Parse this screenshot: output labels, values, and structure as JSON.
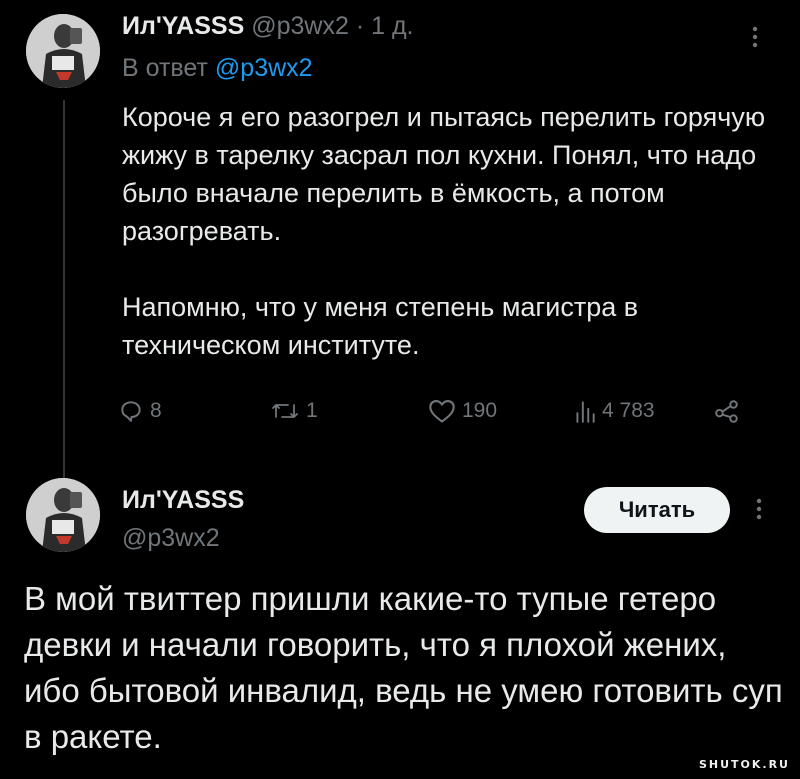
{
  "reply_tweet": {
    "author_name": "Ил'YASSS",
    "handle": "@p3wx2",
    "time_separator": "·",
    "time": "1 д.",
    "reply_to_prefix": "В ответ",
    "reply_to_handle": "@p3wx2",
    "text": "Короче я его разогрел и пытаясь перелить горячую жижу в тарелку засрал пол кухни. Понял, что надо было вначале перелить в ёмкость, а потом разогревать.\n\nНапомню, что у меня степень магистра в техническом институте.",
    "stats": {
      "replies": "8",
      "retweets": "1",
      "likes": "190",
      "views": "4 783"
    },
    "icons": {
      "more": "more-vertical-icon",
      "reply": "reply-bubble-icon",
      "retweet": "retweet-icon",
      "like": "heart-icon",
      "views": "bar-chart-icon",
      "share": "share-icon"
    }
  },
  "quoted_tweet": {
    "author_name": "Ил'YASSS",
    "handle": "@p3wx2",
    "follow_label": "Читать",
    "text": "В мой твиттер пришли какие-то тупые гетеро девки и начали говорить, что я плохой жених, ибо бытовой инвалид, ведь не умею готовить суп в ракете."
  },
  "watermark": "SHUTOK.RU",
  "colors": {
    "background": "#000000",
    "text_primary": "#e7e9ea",
    "text_muted": "#71767b",
    "link": "#1d9bf0",
    "button_bg": "#eff3f4"
  }
}
